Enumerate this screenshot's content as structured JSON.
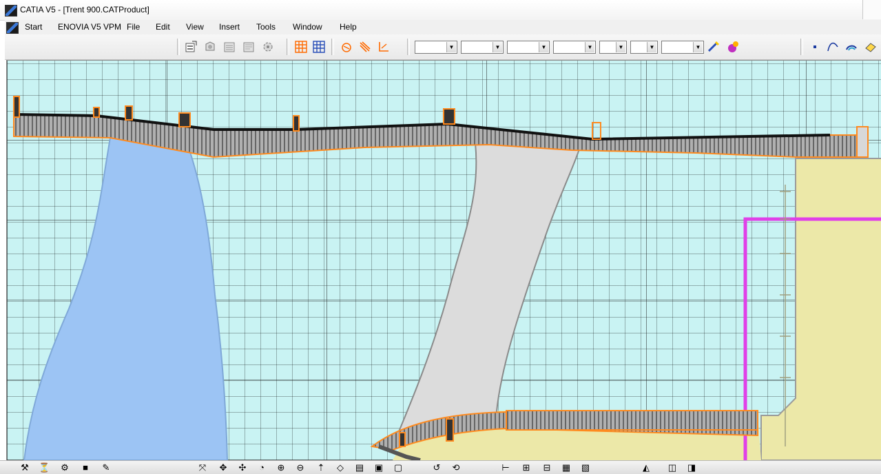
{
  "window": {
    "title": "CATIA V5 - [Trent 900.CATProduct]"
  },
  "menu": {
    "items": [
      {
        "label": "Start"
      },
      {
        "label": "ENOVIA V5 VPM"
      },
      {
        "label": "File"
      },
      {
        "label": "Edit"
      },
      {
        "label": "View"
      },
      {
        "label": "Insert"
      },
      {
        "label": "Tools"
      },
      {
        "label": "Window"
      },
      {
        "label": "Help"
      }
    ]
  },
  "toolbar": {
    "combos": [
      "",
      "",
      "",
      "",
      "",
      "",
      ""
    ],
    "icons": [
      "properties-icon",
      "refresh-icon",
      "layer-icon",
      "catalog-icon",
      "gear-icon",
      "grid-icon",
      "snap-grid-icon",
      "sketch-analysis-icon",
      "constraint-icon",
      "dimension-icon",
      "paintbrush-icon",
      "color-ball-icon",
      "point-icon",
      "curve-icon",
      "arc-icon",
      "eraser-icon"
    ]
  },
  "colors": {
    "background": "#c9f3f3",
    "blade_blue": "#9cc4f4",
    "vane_grey": "#dcdcdc",
    "casing_yellow": "#ece8a8",
    "outline_orange": "#ff8a1e",
    "magenta_line": "#e040e8"
  },
  "bottom_toolbar": {
    "icons": [
      "wrench-icon",
      "funnel-icon",
      "gear-icon",
      "cube-icon",
      "pencil-icon",
      "fit-icon",
      "pan-icon",
      "rotate-icon",
      "fly-icon",
      "zoom-in-icon",
      "zoom-out-icon",
      "normal-view-icon",
      "iso-view-icon",
      "hide-icon",
      "swap-icon",
      "render-icon",
      "measure-icon",
      "analysis-icon",
      "tree-icon",
      "expand-icon",
      "collapse-icon",
      "sketch-icon",
      "section-icon",
      "clash-icon",
      "distance-icon",
      "snapshot-icon"
    ]
  }
}
